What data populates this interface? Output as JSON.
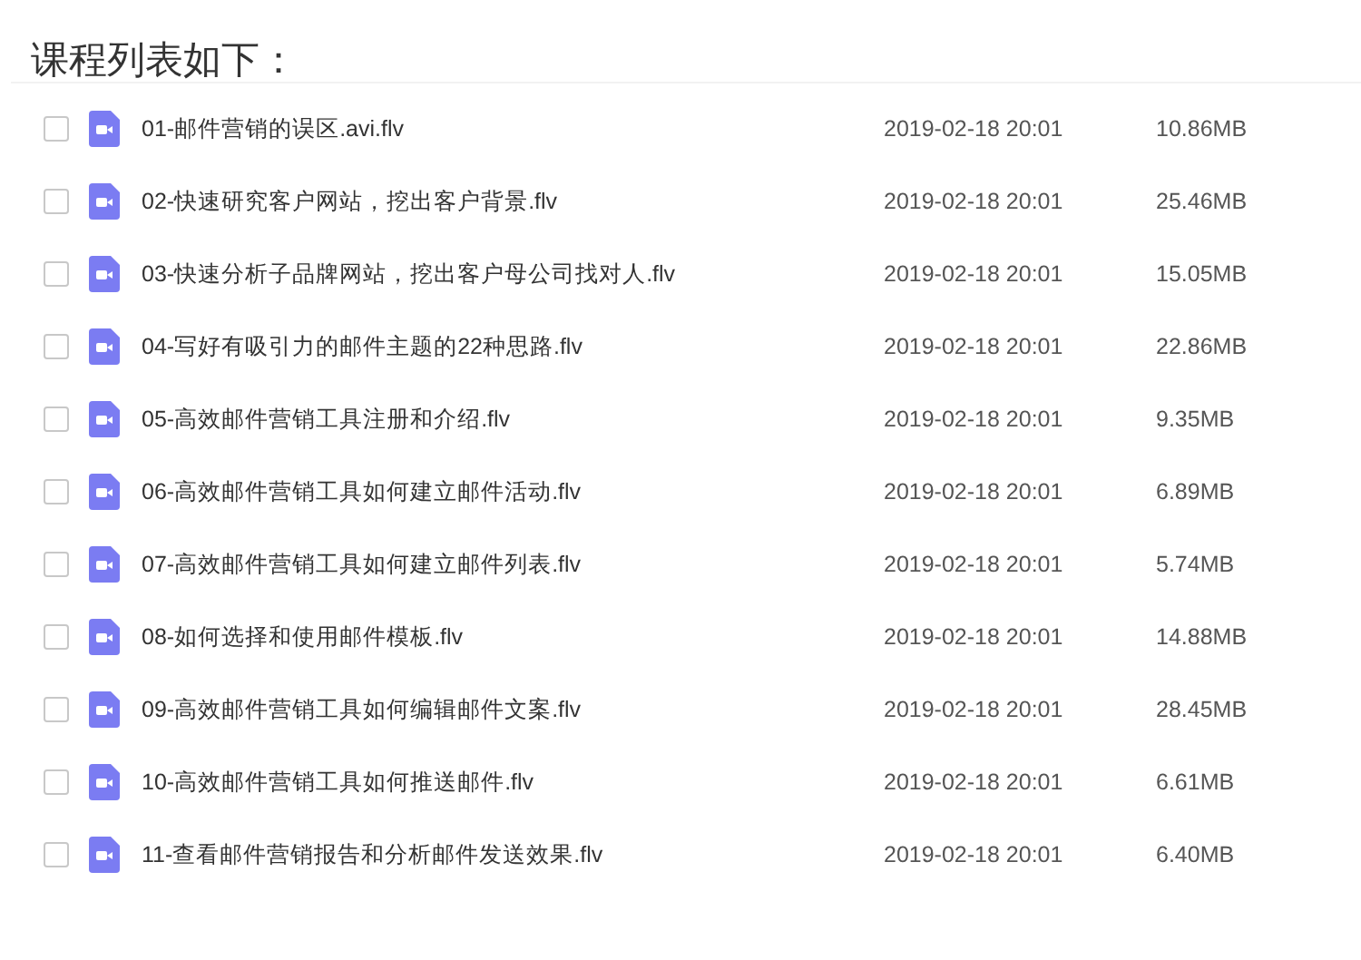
{
  "heading": "课程列表如下：",
  "files": [
    {
      "name": "01-邮件营销的误区.avi.flv",
      "modified": "2019-02-18 20:01",
      "size": "10.86MB",
      "checked": false
    },
    {
      "name": "02-快速研究客户网站，挖出客户背景.flv",
      "modified": "2019-02-18 20:01",
      "size": "25.46MB",
      "checked": false
    },
    {
      "name": "03-快速分析子品牌网站，挖出客户母公司找对人.flv",
      "modified": "2019-02-18 20:01",
      "size": "15.05MB",
      "checked": false
    },
    {
      "name": "04-写好有吸引力的邮件主题的22种思路.flv",
      "modified": "2019-02-18 20:01",
      "size": "22.86MB",
      "checked": false
    },
    {
      "name": "05-高效邮件营销工具注册和介绍.flv",
      "modified": "2019-02-18 20:01",
      "size": "9.35MB",
      "checked": false
    },
    {
      "name": "06-高效邮件营销工具如何建立邮件活动.flv",
      "modified": "2019-02-18 20:01",
      "size": "6.89MB",
      "checked": false
    },
    {
      "name": "07-高效邮件营销工具如何建立邮件列表.flv",
      "modified": "2019-02-18 20:01",
      "size": "5.74MB",
      "checked": false
    },
    {
      "name": "08-如何选择和使用邮件模板.flv",
      "modified": "2019-02-18 20:01",
      "size": "14.88MB",
      "checked": false
    },
    {
      "name": "09-高效邮件营销工具如何编辑邮件文案.flv",
      "modified": "2019-02-18 20:01",
      "size": "28.45MB",
      "checked": false
    },
    {
      "name": "10-高效邮件营销工具如何推送邮件.flv",
      "modified": "2019-02-18 20:01",
      "size": "6.61MB",
      "checked": false
    },
    {
      "name": "11-查看邮件营销报告和分析邮件发送效果.flv",
      "modified": "2019-02-18 20:01",
      "size": "6.40MB",
      "checked": false
    }
  ]
}
